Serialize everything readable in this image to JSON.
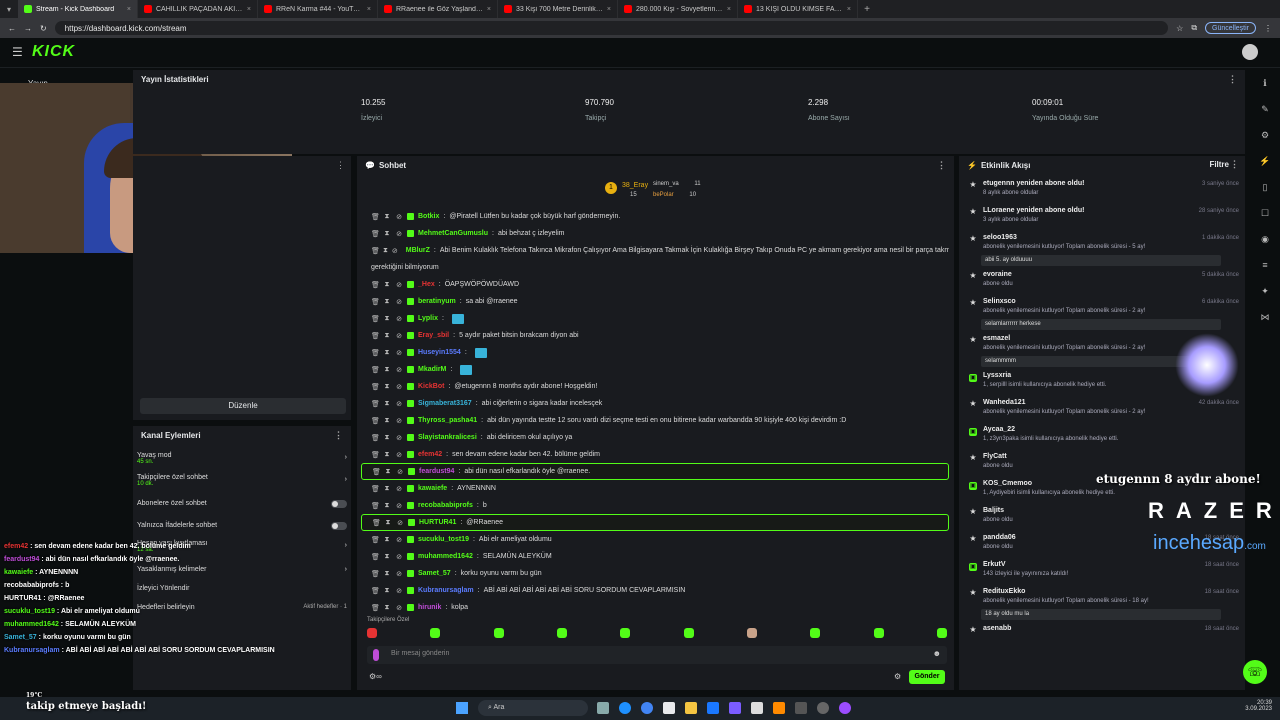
{
  "browser": {
    "tabs": [
      {
        "title": "Stream - Kick Dashboard",
        "color": "#53fc18",
        "active": true
      },
      {
        "title": "CAHİLLİK PAÇADAN AKIYOR | SSI",
        "color": "#ff0000"
      },
      {
        "title": "RReN Karma #44 - YouTube",
        "color": "#ff0000"
      },
      {
        "title": "RRaenee ile Göz Yaşlandıran Oyun",
        "color": "#ff0000"
      },
      {
        "title": "33 Kişi 700 Metre Derinlikte Nasıl",
        "color": "#ff0000"
      },
      {
        "title": "280.000 Kişi - Sovyetlerin Tüm D",
        "color": "#ff0000"
      },
      {
        "title": "13 KİŞİ ÖLDÜ KİMSE FARK ETME",
        "color": "#ff0000"
      }
    ],
    "url": "https://dashboard.kick.com/stream",
    "update_label": "Güncelleştir"
  },
  "app": {
    "logo": "KICK",
    "left_section_label": "Yayın"
  },
  "stats": {
    "title": "Yayın İstatistikleri",
    "items": [
      {
        "value": "10.255",
        "label": "İzleyici"
      },
      {
        "value": "970.790",
        "label": "Takipçi"
      },
      {
        "value": "2.298",
        "label": "Abone Sayısı"
      },
      {
        "value": "00:09:01",
        "label": "Yayında Olduğu Süre"
      }
    ]
  },
  "edit_button": "Düzenle",
  "channel_actions": {
    "title": "Kanal Eylemleri",
    "items": [
      {
        "label": "Yavaş mod",
        "sub": "45 sn."
      },
      {
        "label": "Takipçilere özel sohbet",
        "sub": "10 dk."
      },
      {
        "label": "Abonelere özel sohbet",
        "sub": ""
      },
      {
        "label": "Yalnızca İfadelerle sohbet",
        "sub": ""
      },
      {
        "label": "Hesap yaşı kısıtlaması",
        "sub": "12 sa."
      },
      {
        "label": "Yasaklanmış kelimeler",
        "sub": ""
      },
      {
        "label": "İzleyici Yönlendir",
        "sub": ""
      },
      {
        "label": "Hedefleri belirleyin",
        "sub": ""
      }
    ],
    "goal_status": "Aktif hedefler · 1"
  },
  "chat": {
    "title": "Sohbet",
    "top": [
      {
        "rank": "1",
        "name": "38_Eray",
        "count": "15"
      },
      {
        "rank": "",
        "name": "sinem_va",
        "count": "11"
      },
      {
        "rank": "",
        "name": "bePolar",
        "count": "10"
      }
    ],
    "messages": [
      {
        "user": "Botkix",
        "color": "#53fc18",
        "text": "@Piratell Lütfen bu kadar çok büyük harf göndermeyin.",
        "hl": false
      },
      {
        "user": "MehmetCanGumuslu",
        "color": "#53fc18",
        "text": "abi behzat ç izleyelim",
        "hl": false
      },
      {
        "user": "MBlurZ",
        "color": "#53fc18",
        "text": "Abi Benim Kulaklık Telefona Takınca Mikrafon Çalışıyor Ama Bilgisayara Takmak İçin Kulaklığa Birşey Takıp Onuda PC ye akmam gerekiyor ama nesil bir parça takmam",
        "hl": false
      },
      {
        "user": "",
        "color": "#dcdcdc",
        "text": "gerektiğini bilmiyorum",
        "hl": false
      },
      {
        "user": "_Hex",
        "color": "#e63333",
        "text": "ÖAPŞWÖPÖWDÜAWD",
        "hl": false
      },
      {
        "user": "beratinyum",
        "color": "#53fc18",
        "text": "sa abi @rraenee",
        "hl": false
      },
      {
        "user": "Lyplix",
        "color": "#53fc18",
        "text": "",
        "hl": false
      },
      {
        "user": "Eray_sbil",
        "color": "#e63333",
        "text": "5 aydır paket bitsin bırakcam diyon abi",
        "hl": false
      },
      {
        "user": "Huseyin1554",
        "color": "#5b7cff",
        "text": "",
        "hl": false
      },
      {
        "user": "MkadirM",
        "color": "#53fc18",
        "text": "",
        "hl": false
      },
      {
        "user": "KickBot",
        "color": "#e63333",
        "text": "@etugennn 8 months aydır abone! Hoşgeldin!",
        "hl": false
      },
      {
        "user": "Sigmaberat3167",
        "color": "#38b3d9",
        "text": "abi ciğerlerin o sigara kadar incelesçek",
        "hl": false
      },
      {
        "user": "Thyross_pasha41",
        "color": "#53fc18",
        "text": "abi dün yayında testte 12 soru vardı dizi seçme testi en onu bitirene kadar warbandda 90 kişiyle 400 kişi devirdim :D",
        "hl": false
      },
      {
        "user": "Slayistankralicesi",
        "color": "#53fc18",
        "text": "abi deliricem okul açılıyo ya",
        "hl": false
      },
      {
        "user": "efem42",
        "color": "#e63333",
        "text": "sen devam edene kadar ben 42. bölüme geldim",
        "hl": false
      },
      {
        "user": "feardust94",
        "color": "#c04dd8",
        "text": "abi dün nasıl efkarlandık öyle @rraenee.",
        "hl": true
      },
      {
        "user": "kawaiefe",
        "color": "#53fc18",
        "text": "AYNENNNN",
        "hl": false
      },
      {
        "user": "recobababiprofs",
        "color": "#53fc18",
        "text": "b",
        "hl": false
      },
      {
        "user": "HURTUR41",
        "color": "#53fc18",
        "text": "@RRaenee",
        "hl": true
      },
      {
        "user": "sucuklu_tost19",
        "color": "#53fc18",
        "text": "Abi elr ameliyat oldumu",
        "hl": false
      },
      {
        "user": "muhammed1642",
        "color": "#53fc18",
        "text": "SELAMÜN ALEYKÜM",
        "hl": false
      },
      {
        "user": "Samet_57",
        "color": "#53fc18",
        "text": "korku oyunu varmı bu gün",
        "hl": false
      },
      {
        "user": "Kubranursaglam",
        "color": "#5b7cff",
        "text": "ABİ ABİ ABİ ABİ ABİ ABİ ABİ SORU SORDUM CEVAPLARMISIN",
        "hl": false
      },
      {
        "user": "hirunik",
        "color": "#c04dd8",
        "text": "kolpa",
        "hl": false
      }
    ],
    "followers_only": "Takipçilere Özel",
    "input_placeholder": "Bir mesaj gönderin",
    "send_label": "Gönder"
  },
  "activity": {
    "title": "Etkinlik Akışı",
    "filter_label": "Filtre",
    "items": [
      {
        "name": "etugennn yeniden abone oldu!",
        "detail": "8 aylık abone oldular",
        "time": "3 saniye önce",
        "msg": ""
      },
      {
        "name": "LLoraene yeniden abone oldu!",
        "detail": "3 aylık abone oldular",
        "time": "28 saniye önce",
        "msg": ""
      },
      {
        "name": "seloo1963",
        "detail": "abonelik yenilemesini kutluyor! Toplam abonelik süresi - 5 ay!",
        "time": "1 dakika önce",
        "msg": "abii 5. ay olduuuu"
      },
      {
        "name": "evoraine",
        "detail": "abone oldu",
        "time": "5 dakika önce",
        "msg": ""
      },
      {
        "name": "Selinxsco",
        "detail": "abonelik yenilemesini kutluyor! Toplam abonelik süresi - 2 ay!",
        "time": "6 dakika önce",
        "msg": "selamlarrrrrr herkese"
      },
      {
        "name": "esmazel",
        "detail": "abonelik yenilemesini kutluyor! Toplam abonelik süresi - 2 ay!",
        "time": "",
        "msg": "selammmm"
      },
      {
        "name": "Lyssxria",
        "detail": "1, serpilll isimli kullanıcıya abonelik hediye etti.",
        "time": "",
        "msg": ""
      },
      {
        "name": "Wanheda121",
        "detail": "abonelik yenilemesini kutluyor! Toplam abonelik süresi - 2 ay!",
        "time": "42 dakika önce",
        "msg": ""
      },
      {
        "name": "Aycaa_22",
        "detail": "1, z3yn3paka isimli kullanıcıya abonelik hediye etti.",
        "time": "",
        "msg": ""
      },
      {
        "name": "FlyCatt",
        "detail": "abone oldu",
        "time": "",
        "msg": ""
      },
      {
        "name": "KOS_Cmemoo",
        "detail": "1, Aydiyebiri isimli kullanıcıya abonelik hediye etti.",
        "time": "",
        "msg": ""
      },
      {
        "name": "Baljits",
        "detail": "abone oldu",
        "time": "",
        "msg": ""
      },
      {
        "name": "pandda06",
        "detail": "abone oldu",
        "time": "18 saat önce",
        "msg": ""
      },
      {
        "name": "ErkutV",
        "detail": "143 izleyici ile yayınınıza katıldı!",
        "time": "18 saat önce",
        "msg": ""
      },
      {
        "name": "RedituxEkko",
        "detail": "abonelik yenilemesini kutluyor! Toplam abonelik süresi - 18 ay!",
        "time": "18 saat önce",
        "msg": "18 ay oldu mu la"
      },
      {
        "name": "asenabb",
        "detail": "",
        "time": "18 saat önce",
        "msg": ""
      }
    ]
  },
  "overlay": {
    "sub_alert": "etugennn 8 aydır abone!",
    "sponsor1": "RAZER",
    "sponsor2": "incehesap",
    "sponsor2_suffix": ".com",
    "ticker": "takip etmeye başladı!",
    "weather": "19°C",
    "chat": [
      {
        "user": "efem42",
        "color": "#e63333",
        "text": "sen devam edene kadar ben 42. bölüme geldim"
      },
      {
        "user": "feardust94",
        "color": "#c04dd8",
        "text": "abi dün nasıl efkarlandık öyle @rraenee."
      },
      {
        "user": "kawaiefe",
        "color": "#53fc18",
        "text": "AYNENNNN"
      },
      {
        "user": "recobababiprofs",
        "color": "#ffffff",
        "text": "b"
      },
      {
        "user": "HURTUR41",
        "color": "#ffffff",
        "text": "@RRaenee"
      },
      {
        "user": "sucuklu_tost19",
        "color": "#53fc18",
        "text": "Abi elr ameliyat oldumu"
      },
      {
        "user": "muhammed1642",
        "color": "#53fc18",
        "text": "SELAMÜN ALEYKÜM"
      },
      {
        "user": "Samet_57",
        "color": "#38b3d9",
        "text": "korku oyunu varmı bu gün"
      },
      {
        "user": "Kubranursaglam",
        "color": "#5b7cff",
        "text": "ABİ ABİ ABİ ABİ ABİ ABİ ABİ SORU SORDUM CEVAPLARMISIN"
      }
    ]
  },
  "taskbar": {
    "search": "Ara",
    "time": "20:39",
    "date": "3.09.2023"
  }
}
